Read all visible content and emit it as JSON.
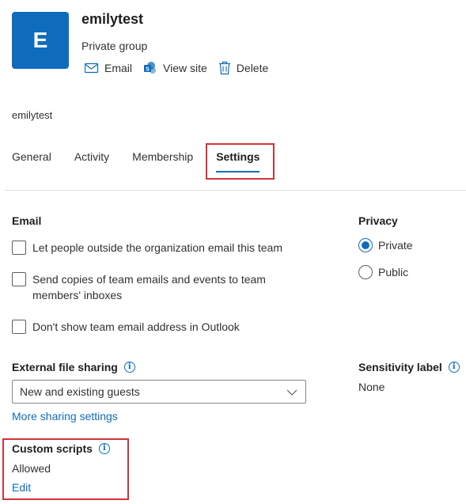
{
  "group": {
    "initial": "E",
    "name": "emilytest",
    "type": "Private group",
    "avatar_color": "#0f6cbd"
  },
  "actions": [
    {
      "label": "Email",
      "icon": "mail-icon"
    },
    {
      "label": "View site",
      "icon": "sharepoint-icon"
    },
    {
      "label": "Delete",
      "icon": "trash-icon"
    }
  ],
  "breadcrumb_name": "emilytest",
  "tabs": [
    {
      "label": "General"
    },
    {
      "label": "Activity"
    },
    {
      "label": "Membership"
    },
    {
      "label": "Settings",
      "active": true
    }
  ],
  "email_section": {
    "title": "Email",
    "options": [
      {
        "label": "Let people outside the organization email this team",
        "checked": false
      },
      {
        "label": "Send copies of team emails and events to team members' inboxes",
        "checked": false
      },
      {
        "label": "Don't show team email address in Outlook",
        "checked": false
      }
    ]
  },
  "privacy": {
    "title": "Privacy",
    "options": [
      {
        "label": "Private",
        "checked": true
      },
      {
        "label": "Public",
        "checked": false
      }
    ]
  },
  "external_sharing": {
    "title": "External file sharing",
    "selected": "New and existing guests",
    "more_link": "More sharing settings"
  },
  "sensitivity": {
    "title": "Sensitivity label",
    "value": "None"
  },
  "custom_scripts": {
    "title": "Custom scripts",
    "value": "Allowed",
    "edit_link": "Edit"
  },
  "colors": {
    "accent": "#0f6cbd",
    "highlight_box": "#d13438"
  }
}
